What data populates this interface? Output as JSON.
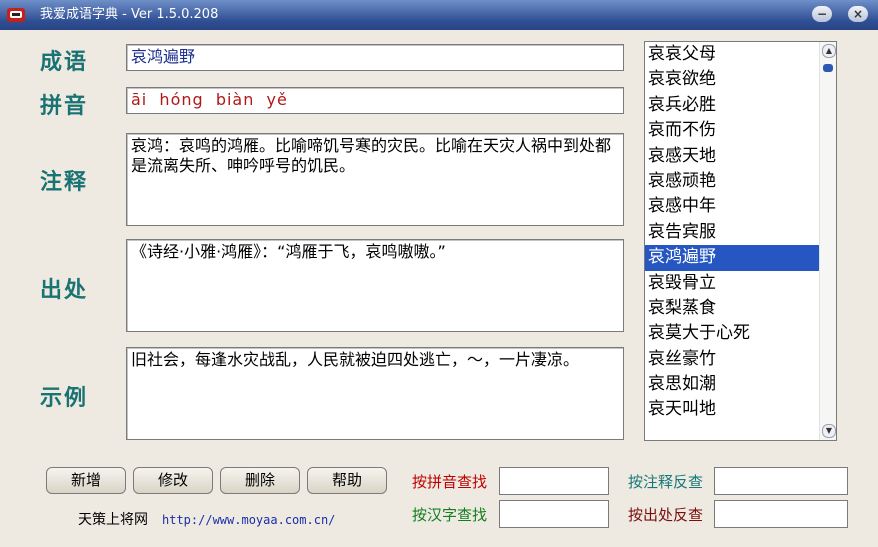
{
  "titlebar": {
    "title": "我爱成语字典 - Ver 1.5.0.208",
    "minimize_glyph": "−",
    "close_glyph": "×"
  },
  "labels": {
    "idiom": "成语",
    "pinyin": "拼音",
    "notes": "注释",
    "source": "出处",
    "example": "示例"
  },
  "fields": {
    "idiom": "哀鸿遍野",
    "pinyin": "āi  hóng  biàn  yě",
    "notes": "哀鸿：哀鸣的鸿雁。比喻啼饥号寒的灾民。比喻在天灾人祸中到处都是流离失所、呻吟呼号的饥民。",
    "source": "《诗经·小雅·鸿雁》：“鸿雁于飞，哀鸣嗷嗷。”",
    "example": "旧社会，每逢水灾战乱，人民就被迫四处逃亡，～，一片凄凉。"
  },
  "list": {
    "items": [
      "哀哀父母",
      "哀哀欲绝",
      "哀兵必胜",
      "哀而不伤",
      "哀感天地",
      "哀感顽艳",
      "哀感中年",
      "哀告宾服",
      "哀鸿遍野",
      "哀毁骨立",
      "哀梨蒸食",
      "哀莫大于心死",
      "哀丝豪竹",
      "哀思如潮",
      "哀天叫地"
    ],
    "selected": "哀鸿遍野"
  },
  "buttons": {
    "add": "新增",
    "edit": "修改",
    "delete": "删除",
    "help": "帮助"
  },
  "search": {
    "by_pinyin": "按拼音查找",
    "by_hanzi": "按汉字查找",
    "by_notes": "按注释反查",
    "by_source": "按出处反查"
  },
  "footer": {
    "site_name": "天策上将网",
    "url": "http://www.moyaa.com.cn/"
  },
  "colors": {
    "accent": "#1a7373",
    "title_bar": "#2f4f94",
    "selection": "#2656c2"
  }
}
